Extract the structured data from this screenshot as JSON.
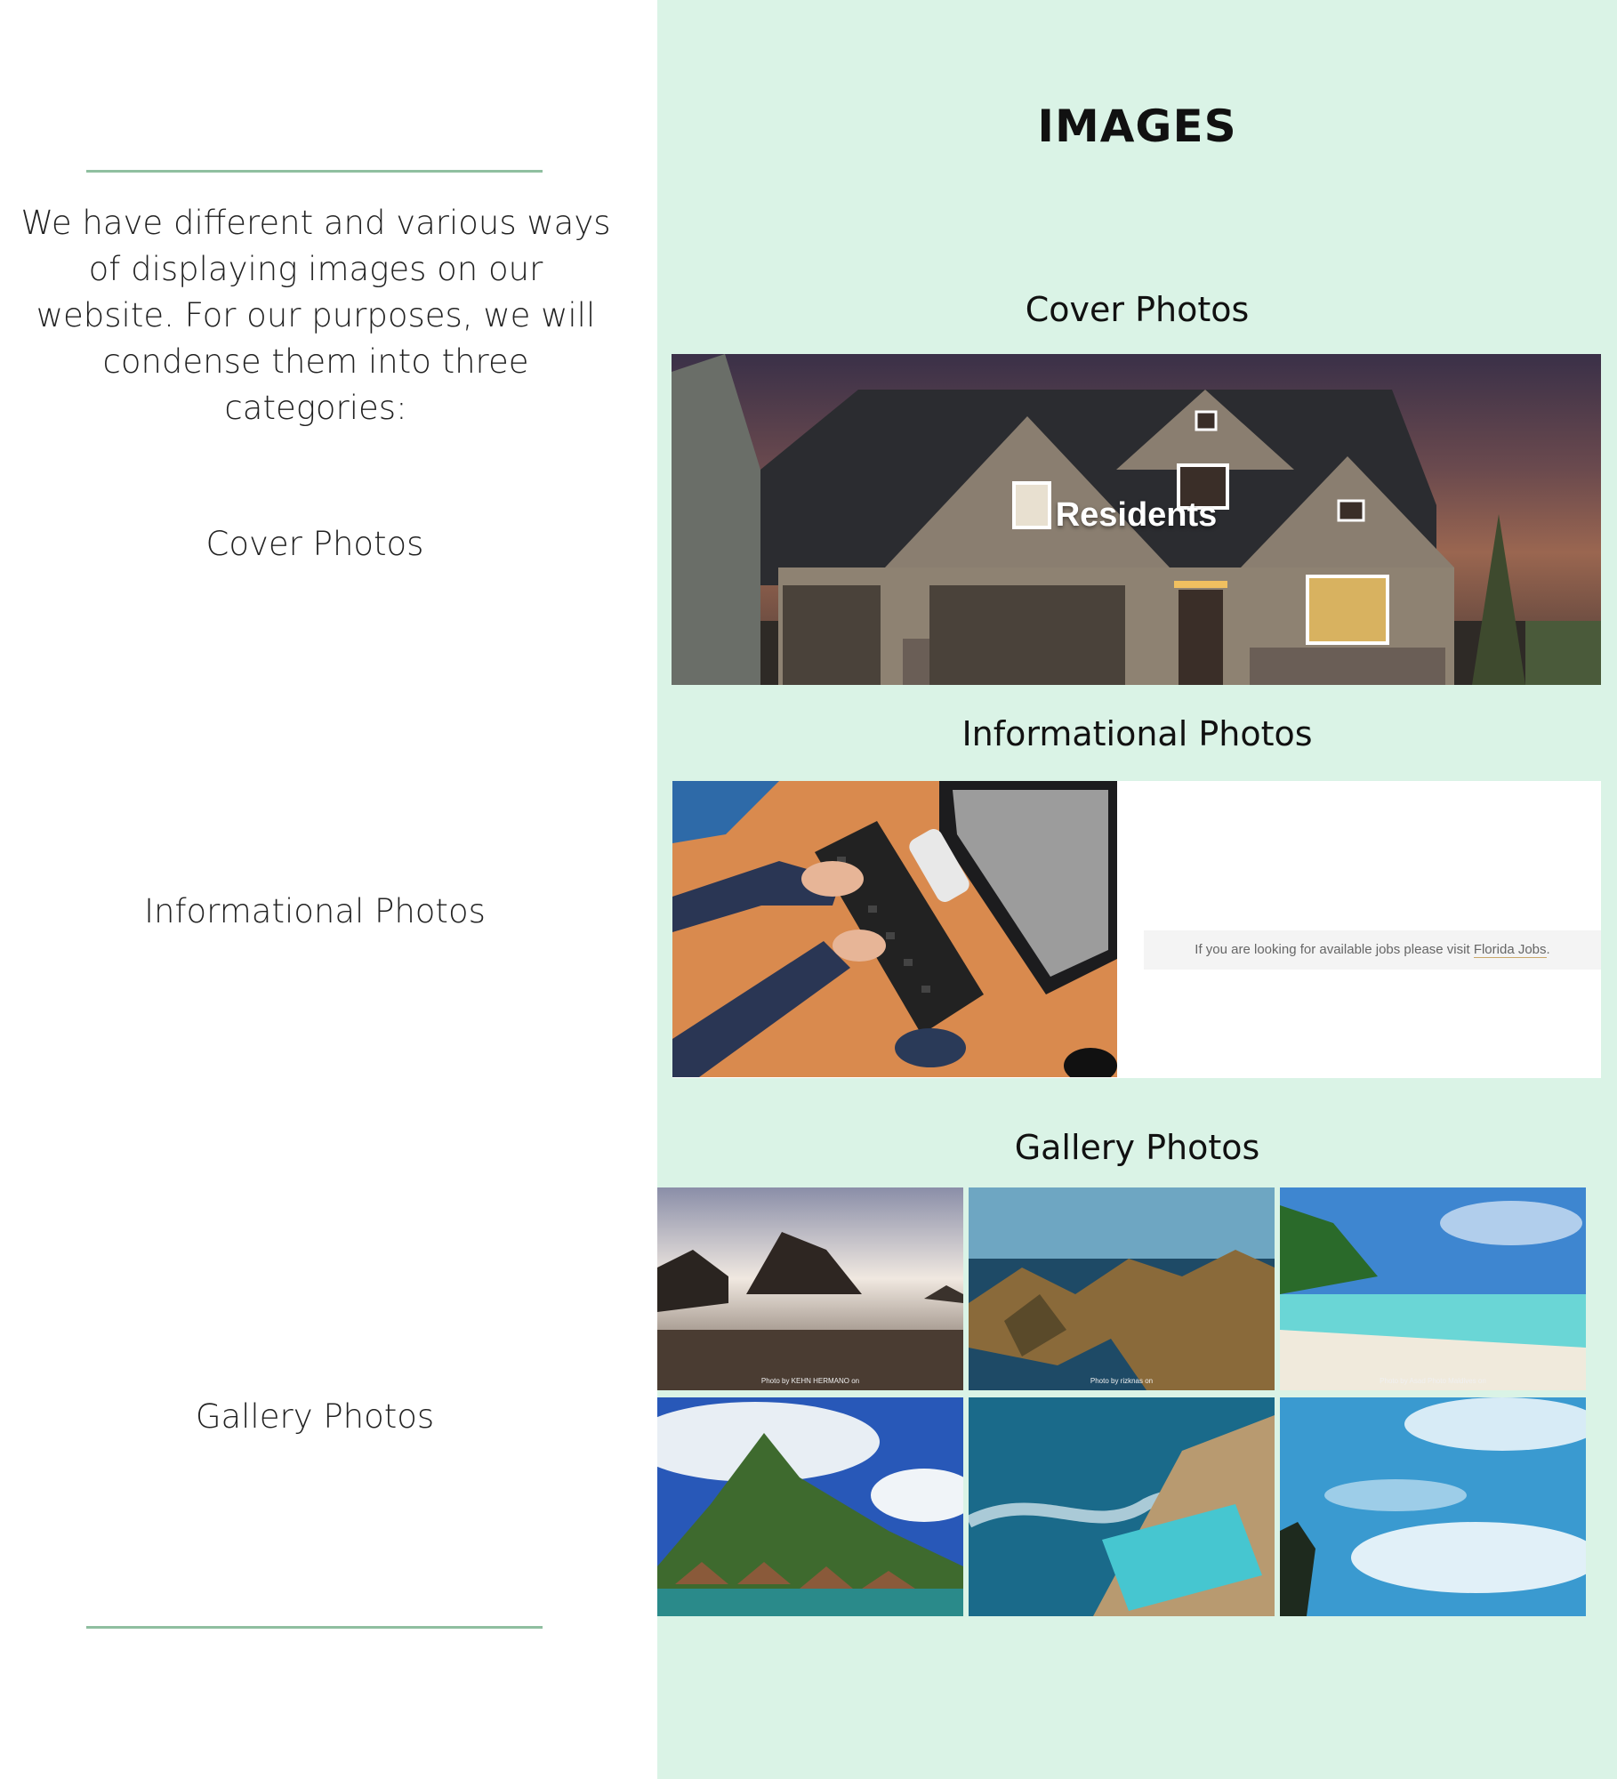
{
  "left": {
    "intro": "We have different and various ways of displaying images on our website. For our purposes, we will condense them into three categories:",
    "labels": [
      "Cover Photos",
      "Informational Photos",
      "Gallery Photos"
    ]
  },
  "right": {
    "title": "IMAGES",
    "cover": {
      "heading": "Cover Photos",
      "overlay": "Residents"
    },
    "info": {
      "heading": "Informational Photos",
      "text_prefix": "If you are looking for available jobs please visit ",
      "link": "Florida Jobs",
      "text_suffix": "."
    },
    "gallery": {
      "heading": "Gallery Photos",
      "credits": [
        "Photo by KEHN HERMANO on",
        "Photo by rizknas on",
        "Photo by Asad Photo Maldives on"
      ]
    }
  },
  "colors": {
    "panel": "#daf3e6",
    "rule": "#8fbfa0"
  }
}
